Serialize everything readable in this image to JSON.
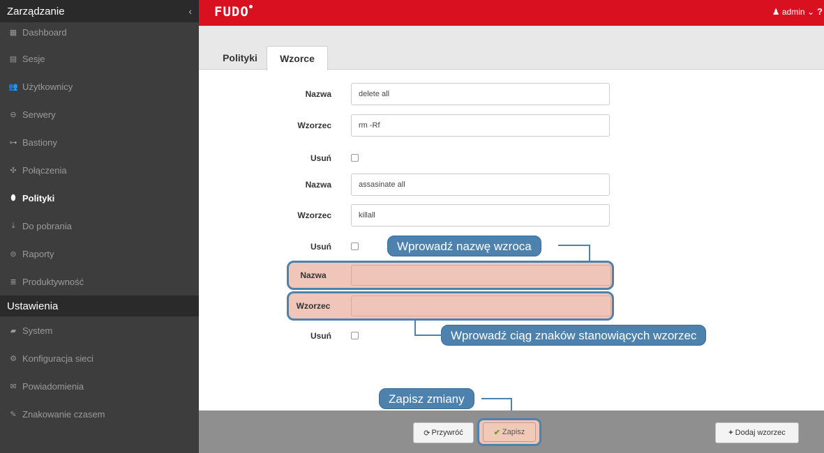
{
  "sidebar": {
    "header": "Zarządzanie",
    "collapse_icon": "‹",
    "items": [
      {
        "label": "Dashboard",
        "icon": "▦"
      },
      {
        "label": "Sesje",
        "icon": "▤"
      },
      {
        "label": "Użytkownicy",
        "icon": "👥"
      },
      {
        "label": "Serwery",
        "icon": "⊖"
      },
      {
        "label": "Bastiony",
        "icon": "⊶"
      },
      {
        "label": "Połączenia",
        "icon": "✣"
      },
      {
        "label": "Polityki",
        "icon": "⬮"
      },
      {
        "label": "Do pobrania",
        "icon": "⤓"
      },
      {
        "label": "Raporty",
        "icon": "⊜"
      },
      {
        "label": "Produktywność",
        "icon": "≣"
      }
    ],
    "section2": "Ustawienia",
    "items2": [
      {
        "label": "System",
        "icon": "▰"
      },
      {
        "label": "Konfiguracja sieci",
        "icon": "⚙"
      },
      {
        "label": "Powiadomienia",
        "icon": "✉"
      },
      {
        "label": "Znakowanie czasem",
        "icon": "✎"
      }
    ]
  },
  "topbar": {
    "logo": "FUDO",
    "user": "admin",
    "user_icon": "♟",
    "chevron": "⌄",
    "help": "?"
  },
  "tabs": [
    "Polityki",
    "Wzorce"
  ],
  "form": {
    "rows": [
      {
        "label": "Nazwa",
        "value": "delete all"
      },
      {
        "label": "Wzorzec",
        "value": "rm -Rf"
      },
      {
        "label": "Usuń"
      },
      {
        "label": "Nazwa",
        "value": "assasinate all"
      },
      {
        "label": "Wzorzec",
        "value": "killall"
      },
      {
        "label": "Usuń"
      },
      {
        "label": "Nazwa",
        "value": ""
      },
      {
        "label": "Wzorzec",
        "value": ""
      },
      {
        "label": "Usuń"
      }
    ]
  },
  "callouts": {
    "name": "Wprowadź nazwę wzroca",
    "pattern": "Wprowadź ciąg znaków stanowiących wzorzec",
    "save": "Zapisz zmiany"
  },
  "buttons": {
    "revert": "Przywróć",
    "save": "Zapisz",
    "add": "Dodaj wzorzec"
  },
  "colors": {
    "topbar": "#d8101f",
    "sidebar": "#3d3d3d",
    "callout": "#4c82ad",
    "highlight": "#f0c6bb"
  }
}
